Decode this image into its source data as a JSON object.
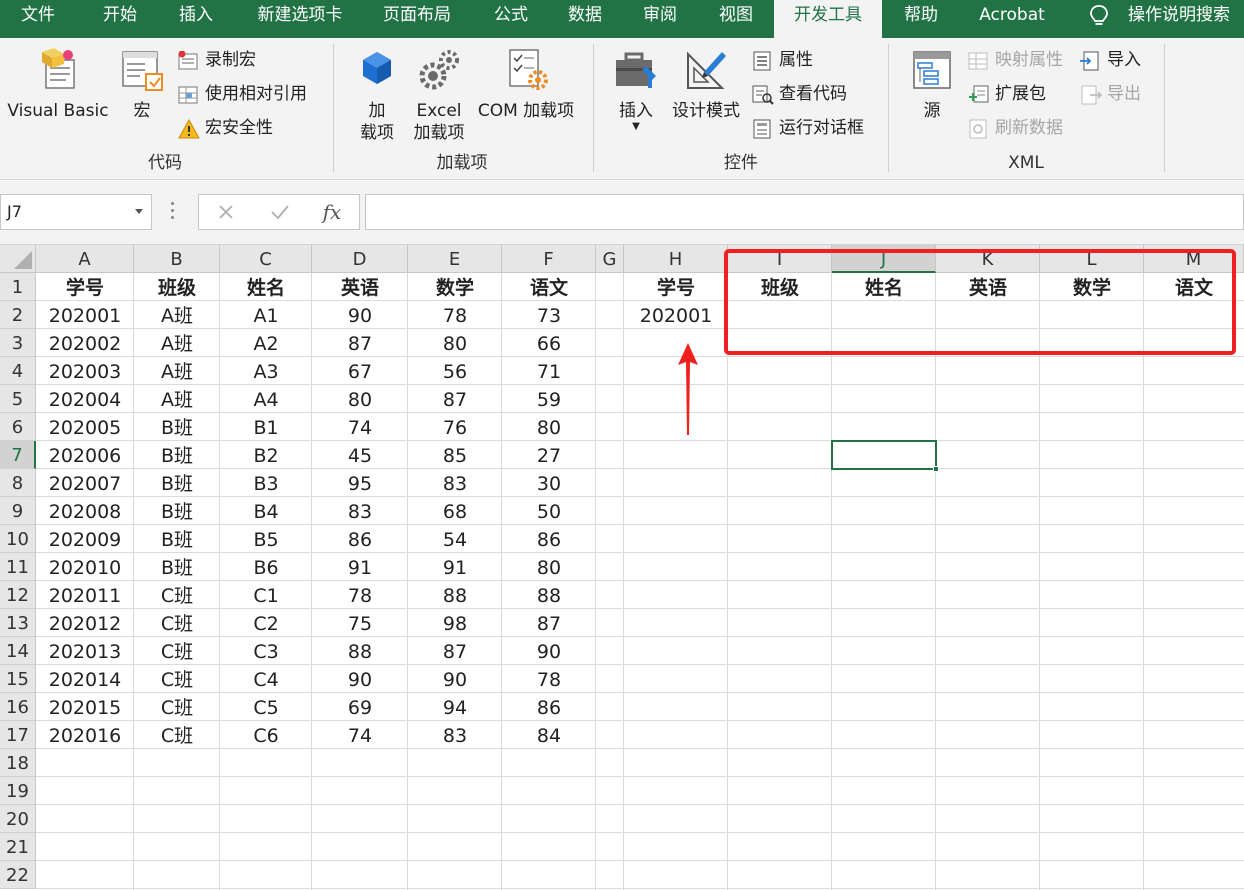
{
  "tabs": [
    "文件",
    "开始",
    "插入",
    "新建选项卡",
    "页面布局",
    "公式",
    "数据",
    "审阅",
    "视图",
    "开发工具",
    "帮助",
    "Acrobat"
  ],
  "active_tab": "开发工具",
  "tell_me": "操作说明搜索",
  "ribbon": {
    "code": {
      "label": "代码",
      "visual_basic": "Visual Basic",
      "macros": "宏",
      "record_macro": "录制宏",
      "relative_refs": "使用相对引用",
      "macro_security": "宏安全性"
    },
    "addins": {
      "label": "加载项",
      "addins_line1": "加",
      "addins_line2": "载项",
      "excel_addins_line1": "Excel",
      "excel_addins_line2": "加载项",
      "com_addins": "COM 加载项"
    },
    "controls": {
      "label": "控件",
      "insert": "插入",
      "design_mode": "设计模式",
      "properties": "属性",
      "view_code": "查看代码",
      "run_dialog": "运行对话框"
    },
    "xml": {
      "label": "XML",
      "source": "源",
      "map_properties": "映射属性",
      "expansion_packs": "扩展包",
      "refresh_data": "刷新数据",
      "import": "导入",
      "export": "导出"
    }
  },
  "formula_bar": {
    "name_box": "J7",
    "fx": "fx",
    "formula": ""
  },
  "sheet": {
    "columns": [
      "A",
      "B",
      "C",
      "D",
      "E",
      "F",
      "G",
      "H",
      "I",
      "J",
      "K",
      "L",
      "M"
    ],
    "rows": [
      "1",
      "2",
      "3",
      "4",
      "5",
      "6",
      "7",
      "8",
      "9",
      "10",
      "11",
      "12",
      "13",
      "14",
      "15",
      "16",
      "17",
      "18",
      "19",
      "20",
      "21",
      "22"
    ],
    "selected_cell": "J7",
    "table_headers": [
      "学号",
      "班级",
      "姓名",
      "英语",
      "数学",
      "语文"
    ],
    "table_rows": [
      [
        "202001",
        "A班",
        "A1",
        "90",
        "78",
        "73"
      ],
      [
        "202002",
        "A班",
        "A2",
        "87",
        "80",
        "66"
      ],
      [
        "202003",
        "A班",
        "A3",
        "67",
        "56",
        "71"
      ],
      [
        "202004",
        "A班",
        "A4",
        "80",
        "87",
        "59"
      ],
      [
        "202005",
        "B班",
        "B1",
        "74",
        "76",
        "80"
      ],
      [
        "202006",
        "B班",
        "B2",
        "45",
        "85",
        "27"
      ],
      [
        "202007",
        "B班",
        "B3",
        "95",
        "83",
        "30"
      ],
      [
        "202008",
        "B班",
        "B4",
        "83",
        "68",
        "50"
      ],
      [
        "202009",
        "B班",
        "B5",
        "86",
        "54",
        "86"
      ],
      [
        "202010",
        "B班",
        "B6",
        "91",
        "91",
        "80"
      ],
      [
        "202011",
        "C班",
        "C1",
        "78",
        "88",
        "88"
      ],
      [
        "202012",
        "C班",
        "C2",
        "75",
        "98",
        "87"
      ],
      [
        "202013",
        "C班",
        "C3",
        "88",
        "87",
        "90"
      ],
      [
        "202014",
        "C班",
        "C4",
        "90",
        "90",
        "78"
      ],
      [
        "202015",
        "C班",
        "C5",
        "69",
        "94",
        "86"
      ],
      [
        "202016",
        "C班",
        "C6",
        "74",
        "83",
        "84"
      ]
    ],
    "lookup_headers": [
      "学号",
      "班级",
      "姓名",
      "英语",
      "数学",
      "语文"
    ],
    "lookup_values": [
      "202001",
      "",
      "",
      "",
      "",
      ""
    ]
  },
  "colors": {
    "excel_green": "#217346",
    "annotation_red": "#f02020"
  }
}
